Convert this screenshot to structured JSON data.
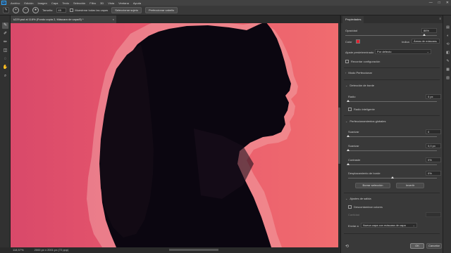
{
  "menubar": {
    "logo": "Ps",
    "items": [
      "Archivo",
      "Edición",
      "Imagen",
      "Capa",
      "Texto",
      "Selección",
      "Filtro",
      "3D",
      "Vista",
      "Ventana",
      "Ayuda"
    ],
    "window_controls": [
      "—",
      "□",
      "✕"
    ]
  },
  "options": {
    "size_label": "Tamaño:",
    "size_value": "45",
    "sample_all_layers_label": "Muestrear todas las capas",
    "select_subject_label": "Seleccionar sujeto",
    "refine_hair_label": "Perfeccionar cabello"
  },
  "document": {
    "tab_title": "k229.psd al 118% (Fondo copia 2, Máscara de capa/8) *",
    "close": "×"
  },
  "status": {
    "zoom": "118,57%",
    "dimensions": "2000 px x 2001 px (72 ppp)"
  },
  "panel": {
    "tab_label": "Propiedades",
    "opacity_label": "Opacidad",
    "opacity_value": "86%",
    "opacity_fraction": 0.86,
    "color_label": "Color",
    "color_value": "#e0202e",
    "indicates_label": "Indica",
    "indicates_value": "Áreas de máscara",
    "auto_adjust_label": "Ajuste predeterminado",
    "auto_adjust_value": "Por defecto",
    "remember_settings_label": "Recordar configuración",
    "refine_mode_label": "Modo Perfeccionar",
    "edge_detection_label": "Detección de borde",
    "radius_label": "Radio",
    "radius_value": "0 px",
    "radius_fraction": 0.0,
    "smart_radius_label": "Radio inteligente",
    "global_refinements_label": "Perfeccionamientos globales",
    "smooth_label": "Suavizar",
    "smooth_value": "0",
    "smooth_fraction": 0.0,
    "feather_label": "Suavizar",
    "feather_value": "0,0 px",
    "feather_fraction": 0.0,
    "contrast_label": "Contraste",
    "contrast_value": "0%",
    "contrast_fraction": 0.0,
    "shift_edge_label": "Desplazamiento de borde",
    "shift_edge_value": "0%",
    "shift_edge_fraction": 0.5,
    "clear_selection_label": "Borrar selección",
    "invert_label": "Invertir",
    "output_settings_label": "Ajustes de salida",
    "decontaminate_label": "Descontaminar colores",
    "amount_label": "Cantidad",
    "output_to_label": "Enviar a",
    "output_to_value": "Nueva capa con máscara de capa",
    "ok_label": "OK",
    "cancel_label": "Cancelar"
  }
}
